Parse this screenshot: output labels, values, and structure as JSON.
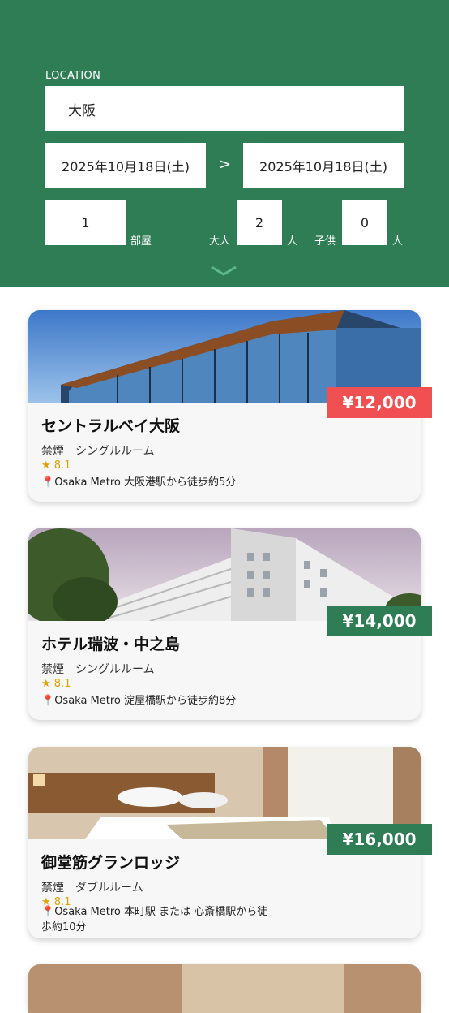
{
  "search": {
    "location_label": "LOCATION",
    "location_value": "大阪",
    "checkin": "2025年10月18日(土)",
    "date_arrow": ">",
    "checkout": "2025年10月18日(土)",
    "rooms_value": "1",
    "rooms_label": "部屋",
    "adults_label": "大人",
    "adults_value": "2",
    "adults_unit": "人",
    "children_label": "子供",
    "children_value": "0",
    "children_unit": "人",
    "expand_icon": "chevron-down-icon"
  },
  "hotels": [
    {
      "name": "セントラルベイ大阪",
      "price": "¥12,000",
      "price_color": "#f05052",
      "room": "禁煙　シングルルーム",
      "rating": "★ 8.1",
      "access": "Osaka Metro 大阪港駅から徒歩約5分"
    },
    {
      "name": "ホテル瑞波・中之島",
      "price": "¥14,000",
      "price_color": "#2f7d55",
      "room": "禁煙　シングルルーム",
      "rating": "★ 8.1",
      "access": "Osaka Metro 淀屋橋駅から徒歩約8分"
    },
    {
      "name": "御堂筋グランロッジ",
      "price": "¥16,000",
      "price_color": "#2f7d55",
      "room": "禁煙　ダブルルーム",
      "rating": "★ 8.1",
      "access": "Osaka Metro 本町駅 または 心斎橋駅から徒歩約10分"
    }
  ],
  "colors": {
    "accent": "#2f7d55",
    "sale": "#f05052",
    "rating": "#e5a000"
  }
}
